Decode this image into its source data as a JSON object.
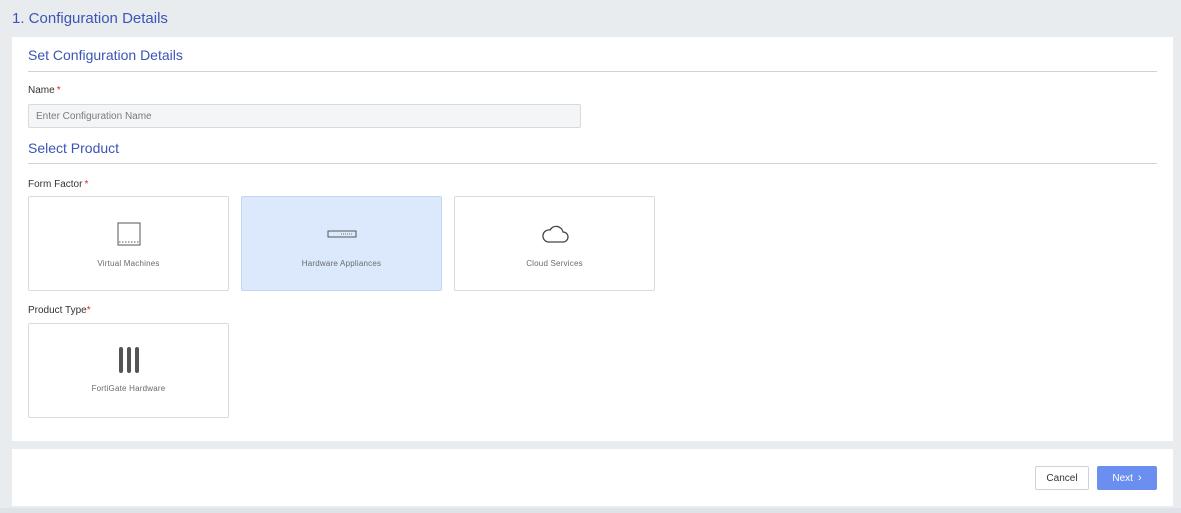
{
  "step": {
    "title": "1. Configuration Details"
  },
  "config_section": {
    "title": "Set Configuration Details"
  },
  "name_field": {
    "label": "Name",
    "required_marker": "*",
    "placeholder": "Enter Configuration Name",
    "value": ""
  },
  "product_section": {
    "title": "Select Product"
  },
  "form_factor": {
    "label": "Form Factor",
    "required_marker": "*",
    "options": [
      {
        "label": "Virtual Machines",
        "icon": "virtual-machine-icon",
        "selected": false
      },
      {
        "label": "Hardware Appliances",
        "icon": "hardware-appliance-icon",
        "selected": true
      },
      {
        "label": "Cloud Services",
        "icon": "cloud-icon",
        "selected": false
      }
    ]
  },
  "product_type": {
    "label": "Product Type",
    "required_marker": "*",
    "options": [
      {
        "label": "FortiGate Hardware",
        "icon": "fortigate-icon",
        "selected": false
      }
    ]
  },
  "footer": {
    "cancel_label": "Cancel",
    "next_label": "Next",
    "next_icon": "chevron-right-icon"
  },
  "colors": {
    "accent": "#3b55b5",
    "primary_button": "#6b8ff0",
    "selected_card": "#dce9fc",
    "required": "#e02424"
  }
}
